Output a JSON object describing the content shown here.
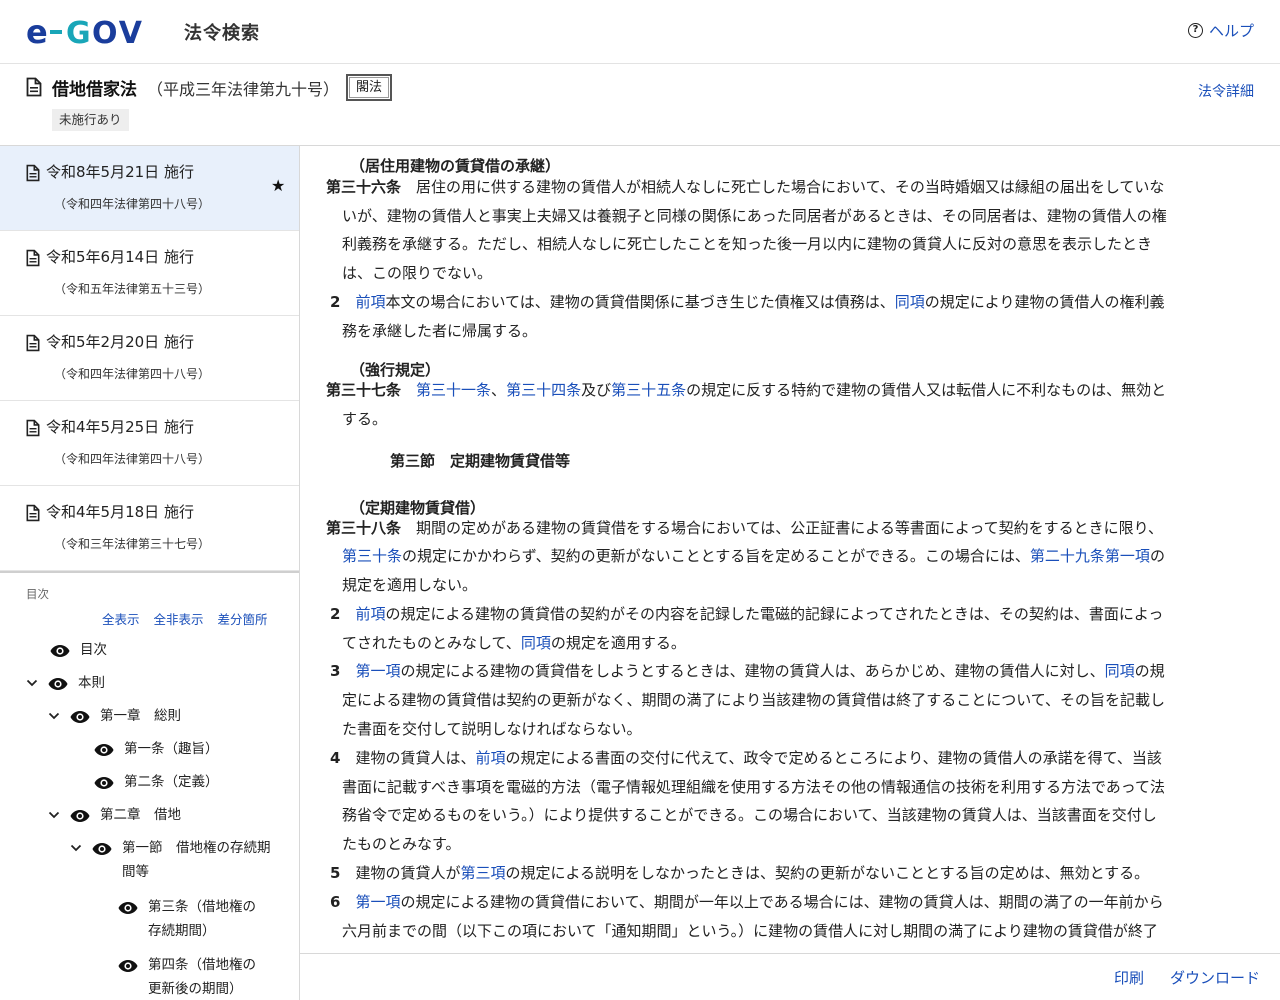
{
  "header": {
    "app_name": "法令検索",
    "help_label": "ヘルプ",
    "logo_text": "e-GOV"
  },
  "law": {
    "title": "借地借家法",
    "number": "（平成三年法律第九十号）",
    "badge": "閣法",
    "detail_link": "法令詳細",
    "status": "未施行あり"
  },
  "versions": [
    {
      "date": "令和8年5月21日 施行",
      "law": "（令和四年法律第四十八号）",
      "active": true
    },
    {
      "date": "令和5年6月14日 施行",
      "law": "（令和五年法律第五十三号）",
      "active": false
    },
    {
      "date": "令和5年2月20日 施行",
      "law": "（令和四年法律第四十八号）",
      "active": false
    },
    {
      "date": "令和4年5月25日 施行",
      "law": "（令和四年法律第四十八号）",
      "active": false
    },
    {
      "date": "令和4年5月18日 施行",
      "law": "（令和三年法律第三十七号）",
      "active": false
    }
  ],
  "toc": {
    "label": "目次",
    "show_all": "全表示",
    "hide_all": "全非表示",
    "diff": "差分箇所",
    "items": [
      {
        "label": "目次"
      },
      {
        "label": "本則"
      },
      {
        "label": "第一章　総則"
      },
      {
        "label": "第一条（趣旨）"
      },
      {
        "label": "第二条（定義）"
      },
      {
        "label": "第二章　借地"
      },
      {
        "label": "第一節　借地権の存続期間等"
      },
      {
        "label": "第三条（借地権の存続期間）"
      },
      {
        "label": "第四条（借地権の更新後の期間）"
      }
    ]
  },
  "content": {
    "a36": {
      "caption": "（居住用建物の賃貸借の承継）",
      "num": "第三十六条",
      "line1": "居住の用に供する建物の賃借人が相続人なしに死亡した場合において、その当時婚姻又は縁組の届出をしていな",
      "line2": "いが、建物の賃借人と事実上夫婦又は養親子と同様の関係にあった同居者があるときは、その同居者は、建物の賃借人の権",
      "line3": "利義務を承継する。ただし、相続人なしに死亡したことを知った後一月以内に建物の賃貸人に反対の意思を表示したとき",
      "line4": "は、この限りでない。",
      "p2_num": "2",
      "p2_ref1": "前項",
      "p2_t1": "本文の場合においては、建物の賃貸借関係に基づき生じた債権又は債務は、",
      "p2_ref2": "同項",
      "p2_t2": "の規定により建物の賃借人の権利義",
      "p2_line2": "務を承継した者に帰属する。"
    },
    "a37": {
      "caption": "（強行規定）",
      "num": "第三十七条",
      "ref1": "第三十一条",
      "sep1": "、",
      "ref2": "第三十四条",
      "sep2": "及び",
      "ref3": "第三十五条",
      "t1": "の規定に反する特約で建物の賃借人又は転借人に不利なものは、無効と",
      "line2": "する。"
    },
    "section": "第三節　定期建物賃貸借等",
    "a38": {
      "caption": "（定期建物賃貸借）",
      "num": "第三十八条",
      "line1": "期間の定めがある建物の賃貸借をする場合においては、公正証書による等書面によって契約をするときに限り、",
      "l2_ref1": "第三十条",
      "l2_t1": "の規定にかかわらず、契約の更新がないこととする旨を定めることができる。この場合には、",
      "l2_ref2": "第二十九条第一項",
      "l2_t2": "の",
      "line3": "規定を適用しない。",
      "p2_num": "2",
      "p2_ref1": "前項",
      "p2_t1": "の規定による建物の賃貸借の契約がその内容を記録した電磁的記録によってされたときは、その契約は、書面によっ",
      "p2_l2_t1": "てされたものとみなして、",
      "p2_l2_ref": "同項",
      "p2_l2_t2": "の規定を適用する。",
      "p3_num": "3",
      "p3_ref1": "第一項",
      "p3_t1": "の規定による建物の賃貸借をしようとするときは、建物の賃貸人は、あらかじめ、建物の賃借人に対し、",
      "p3_ref2": "同項",
      "p3_t2": "の規",
      "p3_line2": "定による建物の賃貸借は契約の更新がなく、期間の満了により当該建物の賃貸借は終了することについて、その旨を記載し",
      "p3_line3": "た書面を交付して説明しなければならない。",
      "p4_num": "4",
      "p4_t1": "建物の賃貸人は、",
      "p4_ref": "前項",
      "p4_t2": "の規定による書面の交付に代えて、政令で定めるところにより、建物の賃借人の承諾を得て、当該",
      "p4_line2": "書面に記載すべき事項を電磁的方法（電子情報処理組織を使用する方法その他の情報通信の技術を利用する方法であって法",
      "p4_line3": "務省令で定めるものをいう。）により提供することができる。この場合において、当該建物の賃貸人は、当該書面を交付し",
      "p4_line4": "たものとみなす。",
      "p5_num": "5",
      "p5_t1": "建物の賃貸人が",
      "p5_ref": "第三項",
      "p5_t2": "の規定による説明をしなかったときは、契約の更新がないこととする旨の定めは、無効とする。",
      "p6_num": "6",
      "p6_ref": "第一項",
      "p6_t1": "の規定による建物の賃貸借において、期間が一年以上である場合には、建物の賃貸人は、期間の満了の一年前から",
      "p6_line2": "六月前までの間（以下この項において「通知期間」という。）に建物の賃借人に対し期間の満了により建物の賃貸借が終了"
    }
  },
  "footer": {
    "print": "印刷",
    "download": "ダウンロード"
  },
  "colors": {
    "link": "#1a4fba",
    "logo_blue": "#1a3d9c",
    "logo_teal": "#19a6b8",
    "active_version_bg": "#e8f0fb"
  }
}
